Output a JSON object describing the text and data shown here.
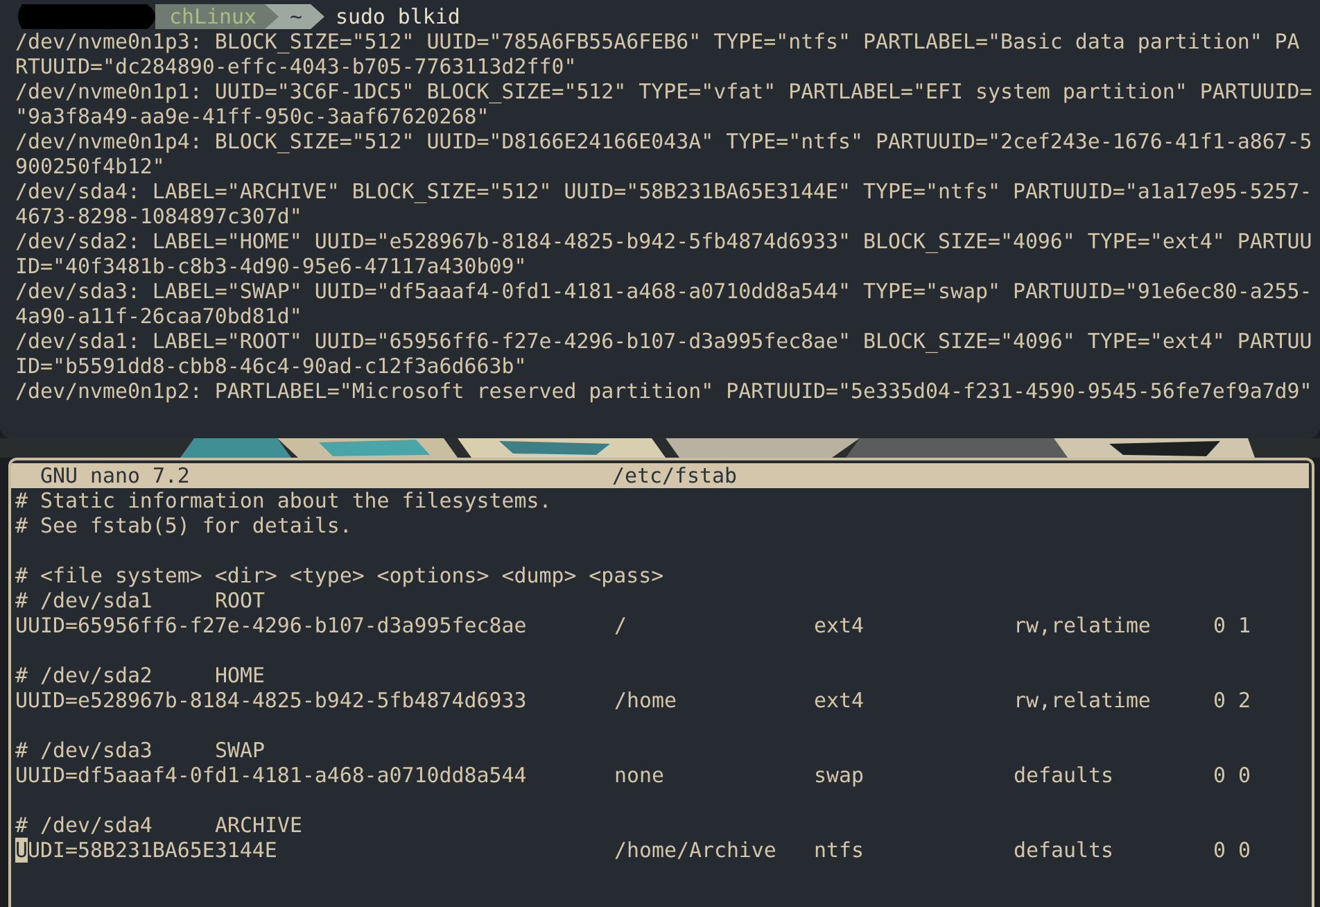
{
  "prompt": {
    "host": "chLinux",
    "path": "~",
    "command": "sudo blkid"
  },
  "output_lines": [
    "/dev/nvme0n1p3: BLOCK_SIZE=\"512\" UUID=\"785A6FB55A6FEB6\" TYPE=\"ntfs\" PARTLABEL=\"Basic data partition\" PA",
    "RTUUID=\"dc284890-effc-4043-b705-7763113d2ff0\"",
    "/dev/nvme0n1p1: UUID=\"3C6F-1DC5\" BLOCK_SIZE=\"512\" TYPE=\"vfat\" PARTLABEL=\"EFI system partition\" PARTUUID=",
    "\"9a3f8a49-aa9e-41ff-950c-3aaf67620268\"",
    "/dev/nvme0n1p4: BLOCK_SIZE=\"512\" UUID=\"D8166E24166E043A\" TYPE=\"ntfs\" PARTUUID=\"2cef243e-1676-41f1-a867-5",
    "900250f4b12\"",
    "/dev/sda4: LABEL=\"ARCHIVE\" BLOCK_SIZE=\"512\" UUID=\"58B231BA65E3144E\" TYPE=\"ntfs\" PARTUUID=\"a1a17e95-5257-",
    "4673-8298-1084897c307d\"",
    "/dev/sda2: LABEL=\"HOME\" UUID=\"e528967b-8184-4825-b942-5fb4874d6933\" BLOCK_SIZE=\"4096\" TYPE=\"ext4\" PARTUU",
    "ID=\"40f3481b-c8b3-4d90-95e6-47117a430b09\"",
    "/dev/sda3: LABEL=\"SWAP\" UUID=\"df5aaaf4-0fd1-4181-a468-a0710dd8a544\" TYPE=\"swap\" PARTUUID=\"91e6ec80-a255-",
    "4a90-a11f-26caa70bd81d\"",
    "/dev/sda1: LABEL=\"ROOT\" UUID=\"65956ff6-f27e-4296-b107-d3a995fec8ae\" BLOCK_SIZE=\"4096\" TYPE=\"ext4\" PARTUU",
    "ID=\"b5591dd8-cbb8-46c4-90ad-c12f3a6d663b\"",
    "/dev/nvme0n1p2: PARTLABEL=\"Microsoft reserved partition\" PARTUUID=\"5e335d04-f231-4590-9545-56fe7ef9a7d9\""
  ],
  "editor": {
    "app": "GNU nano 7.2",
    "file": "/etc/fstab",
    "lines": [
      {
        "kind": "comment",
        "text": "# Static information about the filesystems."
      },
      {
        "kind": "comment",
        "text": "# See fstab(5) for details."
      },
      {
        "kind": "blank"
      },
      {
        "kind": "comment",
        "text": "# <file system> <dir> <type> <options> <dump> <pass>"
      },
      {
        "kind": "device_comment",
        "device": "# /dev/sda1",
        "label": "ROOT"
      },
      {
        "kind": "entry",
        "fs": "UUID=65956ff6-f27e-4296-b107-d3a995fec8ae",
        "dir": "/",
        "type": "ext4",
        "options": "rw,relatime",
        "dump_pass": "0 1",
        "cursor": false
      },
      {
        "kind": "blank"
      },
      {
        "kind": "device_comment",
        "device": "# /dev/sda2",
        "label": "HOME"
      },
      {
        "kind": "entry",
        "fs": "UUID=e528967b-8184-4825-b942-5fb4874d6933",
        "dir": "/home",
        "type": "ext4",
        "options": "rw,relatime",
        "dump_pass": "0 2",
        "cursor": false
      },
      {
        "kind": "blank"
      },
      {
        "kind": "device_comment",
        "device": "# /dev/sda3",
        "label": "SWAP"
      },
      {
        "kind": "entry",
        "fs": "UUID=df5aaaf4-0fd1-4181-a468-a0710dd8a544",
        "dir": "none",
        "type": "swap",
        "options": "defaults",
        "dump_pass": "0 0",
        "cursor": false
      },
      {
        "kind": "blank"
      },
      {
        "kind": "device_comment",
        "device": "# /dev/sda4",
        "label": "ARCHIVE"
      },
      {
        "kind": "entry",
        "fs": "UUDI=58B231BA65E3144E",
        "dir": "/home/Archive",
        "type": "ntfs",
        "options": "defaults",
        "dump_pass": "0 0",
        "cursor": true
      }
    ]
  }
}
